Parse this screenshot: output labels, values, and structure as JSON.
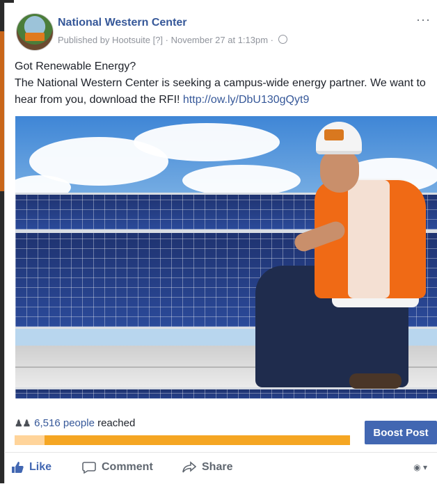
{
  "post": {
    "page_name": "National Western Center",
    "meta": "Published by Hootsuite [?] · November 27 at 1:13pm ·",
    "line1": "Got Renewable Energy?",
    "line2": "The National Western Center is seeking a campus-wide energy partner. We want to hear from you, download the RFI!",
    "link": "http://ow.ly/DbU130gQyt9",
    "more_label": "···"
  },
  "insights": {
    "reached_count": "6,516 people",
    "reached_suffix": "reached",
    "progress_fraction": 1.0
  },
  "buttons": {
    "boost": "Boost Post"
  },
  "actions": {
    "like": "Like",
    "comment": "Comment",
    "share": "Share"
  },
  "icons": [
    "globe-icon",
    "people-icon",
    "like-icon",
    "comment-icon",
    "share-icon",
    "audience-selector-icon",
    "more-icon"
  ],
  "colors": {
    "link": "#365899",
    "boost": "#4267b2",
    "progress": "#f5a623"
  }
}
